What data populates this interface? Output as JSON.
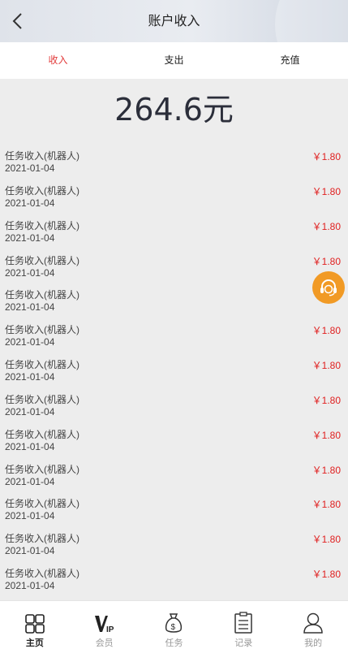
{
  "header": {
    "title": "账户收入",
    "back_icon": "chevron-left-icon"
  },
  "tabs": [
    {
      "label": "收入",
      "active": true
    },
    {
      "label": "支出",
      "active": false
    },
    {
      "label": "充值",
      "active": false
    }
  ],
  "balance": "264.6元",
  "records": [
    {
      "name": "任务收入(机器人)",
      "date": "2021-01-04",
      "amount": "￥1.80"
    },
    {
      "name": "任务收入(机器人)",
      "date": "2021-01-04",
      "amount": "￥1.80"
    },
    {
      "name": "任务收入(机器人)",
      "date": "2021-01-04",
      "amount": "￥1.80"
    },
    {
      "name": "任务收入(机器人)",
      "date": "2021-01-04",
      "amount": "￥1.80"
    },
    {
      "name": "任务收入(机器人)",
      "date": "2021-01-04",
      "amount": ""
    },
    {
      "name": "任务收入(机器人)",
      "date": "2021-01-04",
      "amount": "￥1.80"
    },
    {
      "name": "任务收入(机器人)",
      "date": "2021-01-04",
      "amount": "￥1.80"
    },
    {
      "name": "任务收入(机器人)",
      "date": "2021-01-04",
      "amount": "￥1.80"
    },
    {
      "name": "任务收入(机器人)",
      "date": "2021-01-04",
      "amount": "￥1.80"
    },
    {
      "name": "任务收入(机器人)",
      "date": "2021-01-04",
      "amount": "￥1.80"
    },
    {
      "name": "任务收入(机器人)",
      "date": "2021-01-04",
      "amount": "￥1.80"
    },
    {
      "name": "任务收入(机器人)",
      "date": "2021-01-04",
      "amount": "￥1.80"
    },
    {
      "name": "任务收入(机器人)",
      "date": "2021-01-04",
      "amount": "￥1.80"
    }
  ],
  "customer_service": {
    "icon": "headset-icon",
    "color": "#f19a25"
  },
  "colors": {
    "accent": "#e23b3b",
    "amount": "#e02020"
  },
  "nav": [
    {
      "label": "主页",
      "icon": "grid-icon",
      "active": true
    },
    {
      "label": "会员",
      "icon": "vip-icon",
      "active": false
    },
    {
      "label": "任务",
      "icon": "money-bag-icon",
      "active": false
    },
    {
      "label": "记录",
      "icon": "clipboard-icon",
      "active": false
    },
    {
      "label": "我的",
      "icon": "user-icon",
      "active": false
    }
  ]
}
